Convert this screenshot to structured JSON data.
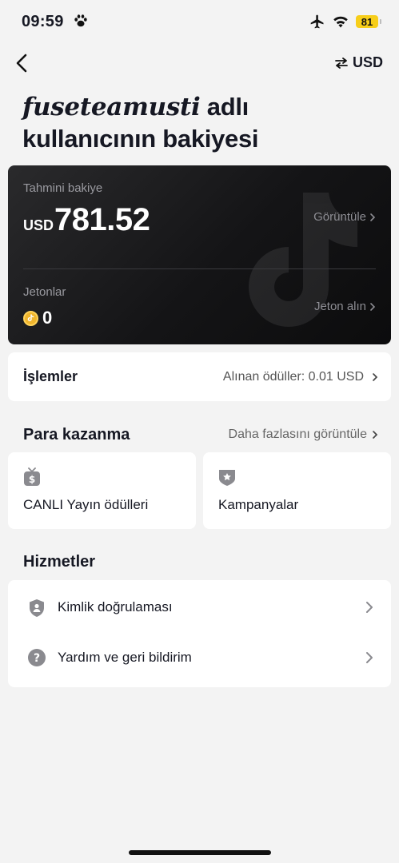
{
  "status_bar": {
    "time": "09:59",
    "battery": "81",
    "icons": [
      "paw-icon",
      "airplane-icon",
      "wifi-icon",
      "battery-icon"
    ]
  },
  "nav": {
    "back_icon": "chevron-left-icon",
    "currency_icon": "swap-arrows-icon",
    "currency_label": "USD"
  },
  "title": {
    "username": "fuseteamusti",
    "suffix": " adlı kullanıcının bakiyesi"
  },
  "balance_card": {
    "estimated_label": "Tahmini bakiye",
    "currency": "USD",
    "amount": "781.52",
    "view_link": "Görüntüle",
    "coins_label": "Jetonlar",
    "coins_value": "0",
    "get_coins_link": "Jeton alın",
    "watermark_icon": "tiktok-logo-icon"
  },
  "transactions": {
    "title": "İşlemler",
    "summary": "Alınan ödüller: 0.01 USD"
  },
  "earn": {
    "title": "Para kazanma",
    "more_link": "Daha fazlasını görüntüle",
    "tiles": [
      {
        "label": "CANLI Yayın ödülleri",
        "icon": "tv-dollar-icon"
      },
      {
        "label": "Kampanyalar",
        "icon": "badge-star-icon"
      }
    ]
  },
  "services": {
    "title": "Hizmetler",
    "items": [
      {
        "label": "Kimlik doğrulaması",
        "icon": "shield-user-icon"
      },
      {
        "label": "Yardım ve geri bildirim",
        "icon": "help-circle-icon"
      }
    ]
  },
  "colors": {
    "background": "#f3f3f3",
    "card_dark": "#141416",
    "battery": "#f7ce1a",
    "coin": "#f0b52c",
    "text_primary": "#161823",
    "text_secondary": "#8d8d93"
  }
}
